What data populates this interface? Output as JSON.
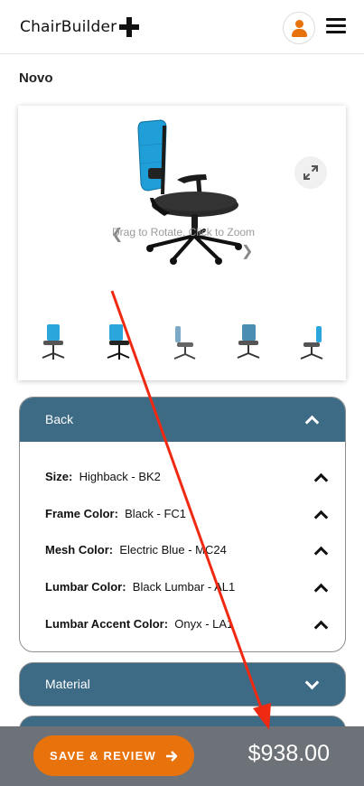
{
  "header": {
    "logo_text": "ChairBuilder",
    "logo_icon": "plus-icon",
    "account_icon": "user-icon",
    "menu_icon": "hamburger-menu-icon"
  },
  "product": {
    "title": "Novo"
  },
  "viewer": {
    "hint": "Drag to Rotate. Click to Zoom",
    "zoom_icon": "expand-icon",
    "prev_icon": "chevron-left-icon",
    "next_icon": "chevron-right-icon",
    "thumbnail_count": 5
  },
  "sections": {
    "back": {
      "label": "Back",
      "expanded": true,
      "options": [
        {
          "name": "Size:",
          "value": "Highback - BK2"
        },
        {
          "name": "Frame Color:",
          "value": "Black - FC1"
        },
        {
          "name": "Mesh Color:",
          "value": "Electric Blue - MC24"
        },
        {
          "name": "Lumbar Color:",
          "value": "Black Lumbar - AL1"
        },
        {
          "name": "Lumbar Accent Color:",
          "value": "Onyx - LA1"
        }
      ]
    },
    "material": {
      "label": "Material",
      "expanded": false
    }
  },
  "footer": {
    "save_label": "SAVE & REVIEW",
    "save_icon": "arrow-right-icon",
    "price": "$938.00"
  },
  "colors": {
    "accent_orange": "#e8720c",
    "section_blue": "#3d6b86",
    "footer_gray": "#6d7278",
    "mesh_blue": "#1f9ed8",
    "annotation_red": "#f02a12"
  }
}
